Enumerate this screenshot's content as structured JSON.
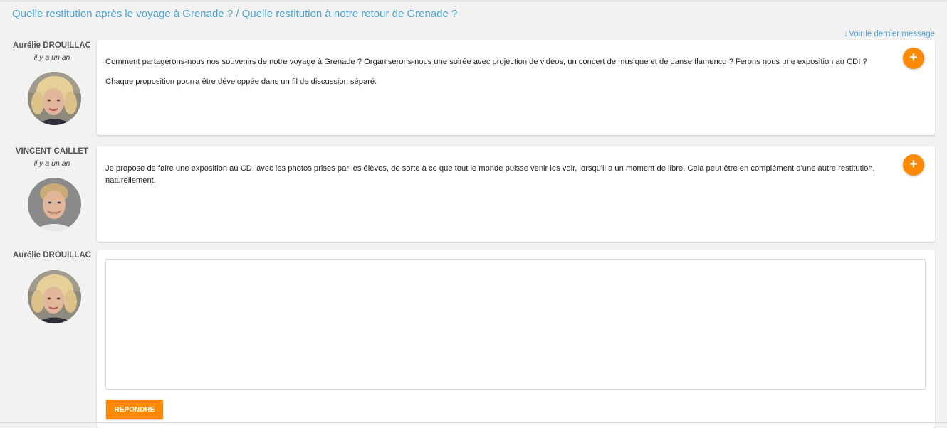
{
  "page": {
    "title": "Quelle restitution après le voyage à Grenade ? / Quelle restitution à notre retour de Grenade ?",
    "last_message_link": "Voir le dernier message",
    "last_message_arrow": "↓"
  },
  "messages": [
    {
      "author": "Aurélie DROUILLAC",
      "time": "il y a un an",
      "paragraphs": [
        "Comment partagerons-nous nos souvenirs de notre voyage à Grenade ? Organiserons-nous une soirée avec projection de vidéos, un concert de musique et de danse flamenco ? Ferons nous une exposition au CDI ?",
        "Chaque proposition pourra être développée dans un fil de discussion séparé."
      ],
      "action_icon": "+"
    },
    {
      "author": "VINCENT CAILLET",
      "time": "il y a un an",
      "paragraphs": [
        "Je propose de faire une exposition au CDI avec les photos prises par les élèves, de sorte à ce que tout le monde puisse venir les voir, lorsqu'il a un moment de libre. Cela peut être en complément d'une autre restitution, naturellement."
      ],
      "action_icon": "+"
    }
  ],
  "reply": {
    "author": "Aurélie DROUILLAC",
    "text_value": "",
    "button_label": "RÉPONDRE"
  },
  "colors": {
    "accent": "#ff8a00",
    "link": "#4fa3d1",
    "background": "#f2f2f2"
  }
}
